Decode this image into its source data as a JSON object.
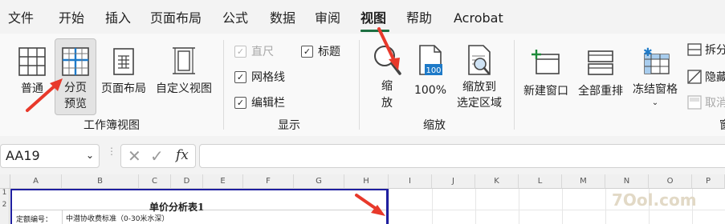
{
  "menu": {
    "items": [
      "文件",
      "开始",
      "插入",
      "页面布局",
      "公式",
      "数据",
      "审阅",
      "视图",
      "帮助",
      "Acrobat"
    ],
    "active_index": 7
  },
  "ribbon": {
    "workbook_views": {
      "normal": "普通",
      "page_break": "分页\n预览",
      "page_layout": "页面布局",
      "custom_view": "自定义视图",
      "label": "工作簿视图"
    },
    "show": {
      "ruler": "直尺",
      "title": "标题",
      "gridlines": "网格线",
      "formula_bar": "编辑栏",
      "label": "显示"
    },
    "zoom": {
      "zoom": "缩\n放",
      "zoom100": "100%",
      "zoom_selection": "缩放到\n选定区域",
      "label": "缩放"
    },
    "window": {
      "new_window": "新建窗口",
      "arrange_all": "全部重排",
      "freeze_panes": "冻结窗格",
      "split": "拆分",
      "hide": "隐藏",
      "unhide": "取消",
      "label": "窗"
    }
  },
  "formula_bar": {
    "name_box": "AA19",
    "fx": "fx"
  },
  "sheet": {
    "columns": [
      "A",
      "B",
      "C",
      "D",
      "E",
      "F",
      "G",
      "H",
      "I",
      "J",
      "K",
      "L",
      "M",
      "N",
      "O",
      "P"
    ],
    "rows": [
      "1",
      "2"
    ],
    "title": "单价分析表1",
    "row3_label": "定额编号：",
    "row3_value": "中潜协收费标准（0-30米水深）",
    "watermark": "7Ool.com"
  },
  "colors": {
    "accent": "#1d6f42",
    "page_break_line": "#1f1fa0",
    "arrow": "#e8392b"
  }
}
